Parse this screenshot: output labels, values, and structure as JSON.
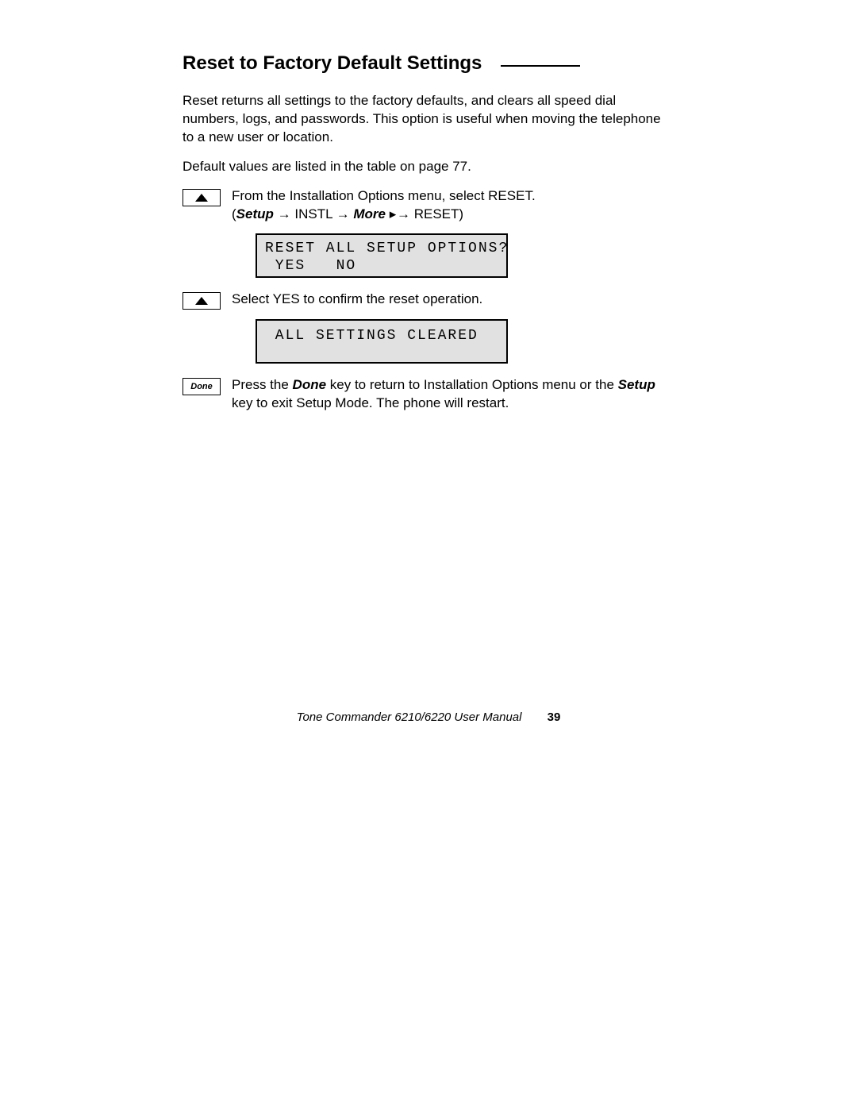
{
  "heading": "Reset to Factory Default Settings",
  "para1": "Reset returns all settings to the factory defaults, and clears all speed dial numbers, logs, and passwords. This option is useful when moving the telephone to a new user or location.",
  "para2": "Default values are listed in the table on page 77.",
  "step1_text": "From the Installation Options menu, select RESET.",
  "bc_open": "(",
  "bc_setup": "Setup",
  "bc_arrow": " → ",
  "bc_instl": "INSTL",
  "bc_more": "More",
  "bc_tri": " ▸ ",
  "bc_reset": "RESET)",
  "lcd1_line1": "RESET ALL SETUP OPTIONS?",
  "lcd1_line2": " YES   NO",
  "step2_text": "Select YES to confirm the reset operation.",
  "lcd2_line1": " ALL SETTINGS CLEARED",
  "done_key": "Done",
  "step3_a": "Press the ",
  "step3_done": "Done",
  "step3_b": " key to return to Installation Options menu or the ",
  "step3_setup": "Setup",
  "step3_c": " key to exit Setup Mode. The phone will restart.",
  "footer_title": "Tone Commander 6210/6220 User Manual",
  "footer_page": "39"
}
